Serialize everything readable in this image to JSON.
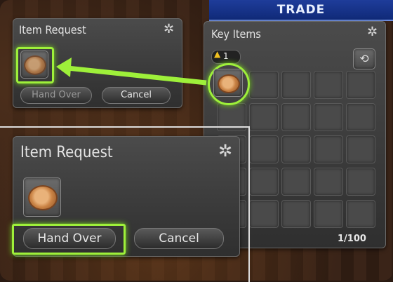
{
  "banner": {
    "title": "TRADE"
  },
  "item_request_small": {
    "title": "Item Request",
    "hand_over_label": "Hand Over",
    "cancel_label": "Cancel"
  },
  "key_items": {
    "title": "Key Items",
    "tab_number": "1",
    "count": "1/100"
  },
  "item_request_zoom": {
    "title": "Item Request",
    "hand_over_label": "Hand Over",
    "cancel_label": "Cancel"
  },
  "colors": {
    "highlight": "#9ef03a",
    "banner": "#1e3c9a"
  },
  "icons": {
    "settings": "gear-icon",
    "item": "pie-item-icon",
    "sort": "bag-icon"
  }
}
